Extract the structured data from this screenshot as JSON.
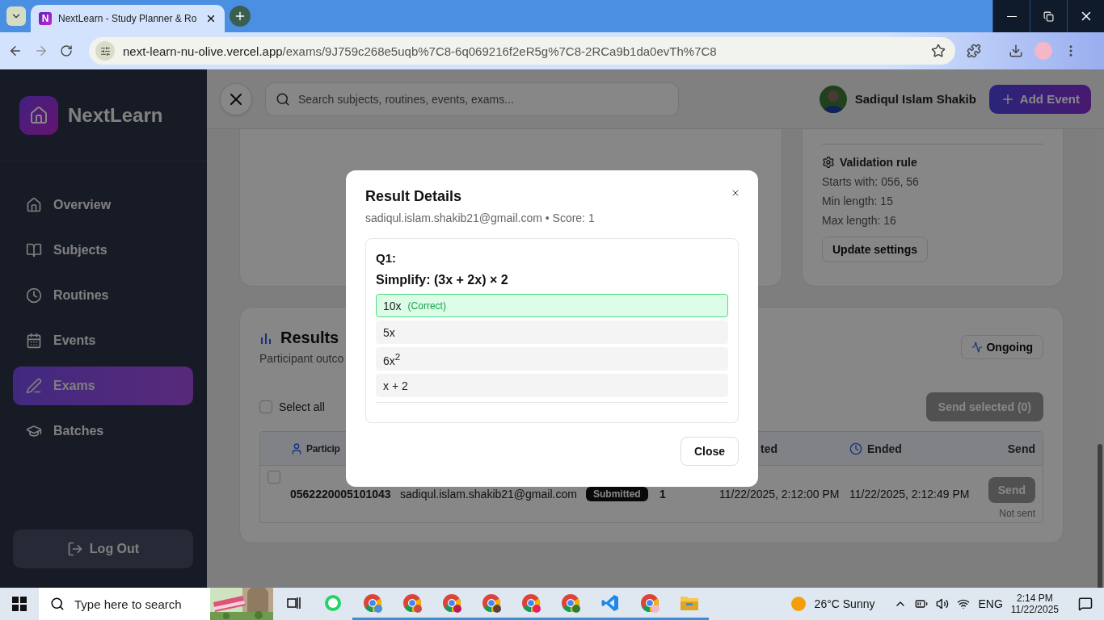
{
  "browser": {
    "favicon_letter": "N",
    "tab_title": "NextLearn - Study Planner & Ro",
    "url_host": "next-learn-nu-olive.vercel.app",
    "url_path": "/exams/9J759c268e5uqb%7C8-6q069216f2eR5g%7C8-2RCa9b1da0evTh%7C8"
  },
  "sidebar": {
    "brand": "NextLearn",
    "items": [
      {
        "label": "Overview",
        "selected": false
      },
      {
        "label": "Subjects",
        "selected": false
      },
      {
        "label": "Routines",
        "selected": false
      },
      {
        "label": "Events",
        "selected": false
      },
      {
        "label": "Exams",
        "selected": true
      },
      {
        "label": "Batches",
        "selected": false
      }
    ],
    "logout": "Log Out"
  },
  "header": {
    "search_placeholder": "Search subjects, routines, events, exams...",
    "user_name": "Sadiqul Islam Shakib",
    "add_button": "Add Event"
  },
  "validation": {
    "title": "Validation rule",
    "lines": [
      "Starts with: 056, 56",
      "Min length: 15",
      "Max length: 16"
    ],
    "button": "Update settings"
  },
  "results": {
    "title": "Results",
    "subtitle": "Participant outco",
    "status": "Ongoing",
    "select_all": {
      "label": "Select all",
      "checked": false
    },
    "send_selected": {
      "label": "Send selected (0)",
      "disabled": true
    },
    "columns": [
      {
        "label": "Particip"
      },
      {
        "label": "ted"
      },
      {
        "label": "Ended"
      },
      {
        "label": "Send"
      }
    ],
    "rows": [
      {
        "checked": false,
        "id": "0562220005101043",
        "email": "sadiqul.islam.shakib21@gmail.com",
        "status": "Submitted",
        "score": "1",
        "started": "11/22/2025, 2:12:00 PM",
        "ended": "11/22/2025, 2:12:49 PM",
        "send": "Send",
        "send_status": "Not sent"
      }
    ]
  },
  "modal": {
    "title": "Result Details",
    "subtitle": "sadiqul.islam.shakib21@gmail.com • Score: 1",
    "question_no": "Q1:",
    "question": "Simplify: (3x + 2x) × 2",
    "options": [
      {
        "text": "10x",
        "correct": true,
        "tag": "(Correct)"
      },
      {
        "text": "5x",
        "correct": false
      },
      {
        "text": "6x$^{2}$",
        "correct": false
      },
      {
        "text": "x + 2",
        "correct": false
      }
    ],
    "close": "Close"
  },
  "taskbar": {
    "search_placeholder": "Type here to search",
    "weather": "26°C Sunny",
    "language": "ENG",
    "time": "2:14 PM",
    "date": "11/22/2025"
  }
}
